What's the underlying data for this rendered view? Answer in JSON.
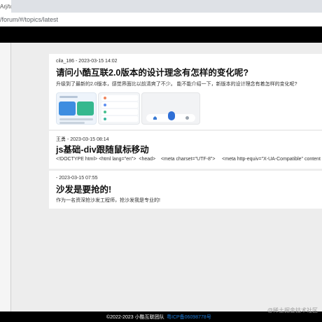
{
  "browser": {
    "tab_title": "Arj/tc",
    "url": "/forum/#/topics/latest"
  },
  "posts": [
    {
      "meta": "cila_186 - 2023-03-15 14:02",
      "title": "请问小酷互联2.0版本的设计理念有怎样的变化呢?",
      "summary": "升级到了最新的2.0版本，感觉界面比以前清爽了不少。 能不能介绍一下，新版本的设计理念有着怎样的变化呢?"
    },
    {
      "meta": "王勇 - 2023-03-15 08:14",
      "title": "js基础-div跟随鼠标移动",
      "summary": "<!DOCTYPE html> <html lang=\"en\">  <head>    <meta charset=\"UTF-8\">     <meta http-equiv=\"X-UA-Compatible\" content"
    },
    {
      "meta": " - 2023-03-15 07:55",
      "title": "沙发是要抢的!",
      "summary": "作为一名资深抢沙发工程师，抢沙发我是专业的!"
    }
  ],
  "footer": {
    "copyright": "©2022-2023 小酷互联团队",
    "icp": "粤ICP备06098778号"
  },
  "watermark": "@稀土掘金技术社区",
  "colors": {
    "top_nav": "#000000",
    "page_bg": "#ededed",
    "card_bg": "#ffffff",
    "link": "#1e7bd8"
  }
}
